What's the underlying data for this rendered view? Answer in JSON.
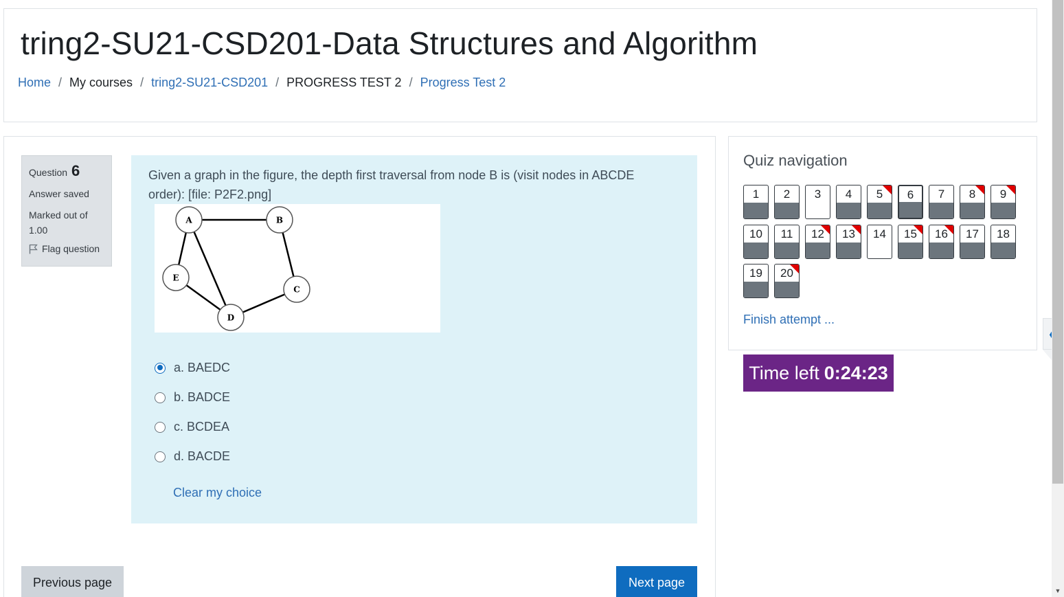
{
  "header": {
    "title": "tring2-SU21-CSD201-Data Structures and Algorithm",
    "breadcrumb": [
      {
        "label": "Home",
        "link": true
      },
      {
        "label": "My courses",
        "link": false
      },
      {
        "label": "tring2-SU21-CSD201",
        "link": true
      },
      {
        "label": "PROGRESS TEST 2",
        "link": false
      },
      {
        "label": "Progress Test 2",
        "link": true
      }
    ],
    "separator": "/"
  },
  "question": {
    "label": "Question",
    "number": "6",
    "status": "Answer saved",
    "marked_out_of": "Marked out of 1.00",
    "flag_label": "Flag question",
    "text": "Given a graph in the figure, the depth first traversal from node B is (visit nodes in ABCDE order): [file: P2F2.png]",
    "graph_nodes": [
      "A",
      "B",
      "C",
      "D",
      "E"
    ],
    "answers": [
      {
        "label": "a. BAEDC",
        "selected": true
      },
      {
        "label": "b. BADCE",
        "selected": false
      },
      {
        "label": "c. BCDEA",
        "selected": false
      },
      {
        "label": "d. BACDE",
        "selected": false
      }
    ],
    "clear_label": "Clear my choice"
  },
  "footer": {
    "prev_label": "Previous page",
    "next_label": "Next page"
  },
  "quiz_nav": {
    "title": "Quiz navigation",
    "finish_label": "Finish attempt ...",
    "questions": [
      {
        "n": "1",
        "answered": true,
        "flagged": false,
        "current": false
      },
      {
        "n": "2",
        "answered": true,
        "flagged": false,
        "current": false
      },
      {
        "n": "3",
        "answered": false,
        "flagged": false,
        "current": false
      },
      {
        "n": "4",
        "answered": true,
        "flagged": false,
        "current": false
      },
      {
        "n": "5",
        "answered": true,
        "flagged": true,
        "current": false
      },
      {
        "n": "6",
        "answered": true,
        "flagged": false,
        "current": true
      },
      {
        "n": "7",
        "answered": true,
        "flagged": false,
        "current": false
      },
      {
        "n": "8",
        "answered": true,
        "flagged": true,
        "current": false
      },
      {
        "n": "9",
        "answered": true,
        "flagged": true,
        "current": false
      },
      {
        "n": "10",
        "answered": true,
        "flagged": false,
        "current": false
      },
      {
        "n": "11",
        "answered": true,
        "flagged": false,
        "current": false
      },
      {
        "n": "12",
        "answered": true,
        "flagged": true,
        "current": false
      },
      {
        "n": "13",
        "answered": true,
        "flagged": true,
        "current": false
      },
      {
        "n": "14",
        "answered": false,
        "flagged": false,
        "current": false
      },
      {
        "n": "15",
        "answered": true,
        "flagged": true,
        "current": false
      },
      {
        "n": "16",
        "answered": true,
        "flagged": true,
        "current": false
      },
      {
        "n": "17",
        "answered": true,
        "flagged": false,
        "current": false
      },
      {
        "n": "18",
        "answered": true,
        "flagged": false,
        "current": false
      },
      {
        "n": "19",
        "answered": true,
        "flagged": false,
        "current": false
      },
      {
        "n": "20",
        "answered": true,
        "flagged": true,
        "current": false
      }
    ]
  },
  "timer": {
    "label": "Time left",
    "value": "0:24:23"
  },
  "drawer": {
    "toggle_icon": "chevron-left-icon"
  },
  "colors": {
    "accent": "#0f6cbf",
    "link": "#2f6fb5",
    "question_bg": "#def2f8",
    "timer_bg": "#6b2586",
    "flag": "#e00000",
    "answered_bar": "#6c757d"
  }
}
